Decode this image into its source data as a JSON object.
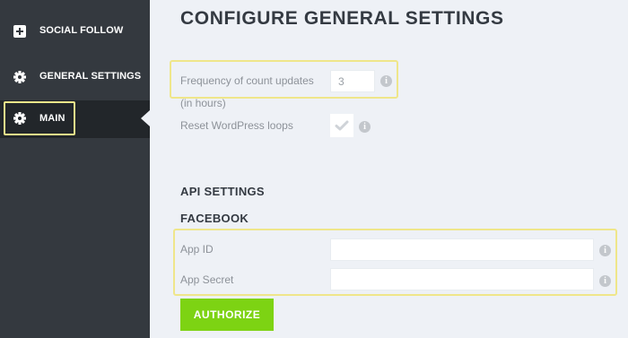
{
  "sidebar": {
    "items": [
      {
        "label": "SOCIAL FOLLOW",
        "icon": "plus-square-icon"
      },
      {
        "label": "GENERAL SETTINGS",
        "icon": "gear-icon"
      },
      {
        "label": "MAIN",
        "icon": "gear-icon",
        "active": true
      }
    ]
  },
  "page": {
    "title": "CONFIGURE GENERAL SETTINGS"
  },
  "general": {
    "frequency_label": "Frequency of count updates",
    "frequency_sub": "(in hours)",
    "frequency_value": "3",
    "reset_label": "Reset WordPress loops",
    "reset_checked": true
  },
  "api": {
    "heading": "API SETTINGS",
    "facebook_heading": "FACEBOOK",
    "app_id_label": "App ID",
    "app_id_value": "",
    "app_secret_label": "App Secret",
    "app_secret_value": "",
    "authorize_label": "AUTHORIZE"
  },
  "info_glyph": "i",
  "colors": {
    "sidebar_bg": "#34393f",
    "sidebar_active_bg": "#22262a",
    "content_bg": "#eef1f6",
    "accent_green": "#7dd313",
    "highlight_yellow": "#efe68a"
  }
}
